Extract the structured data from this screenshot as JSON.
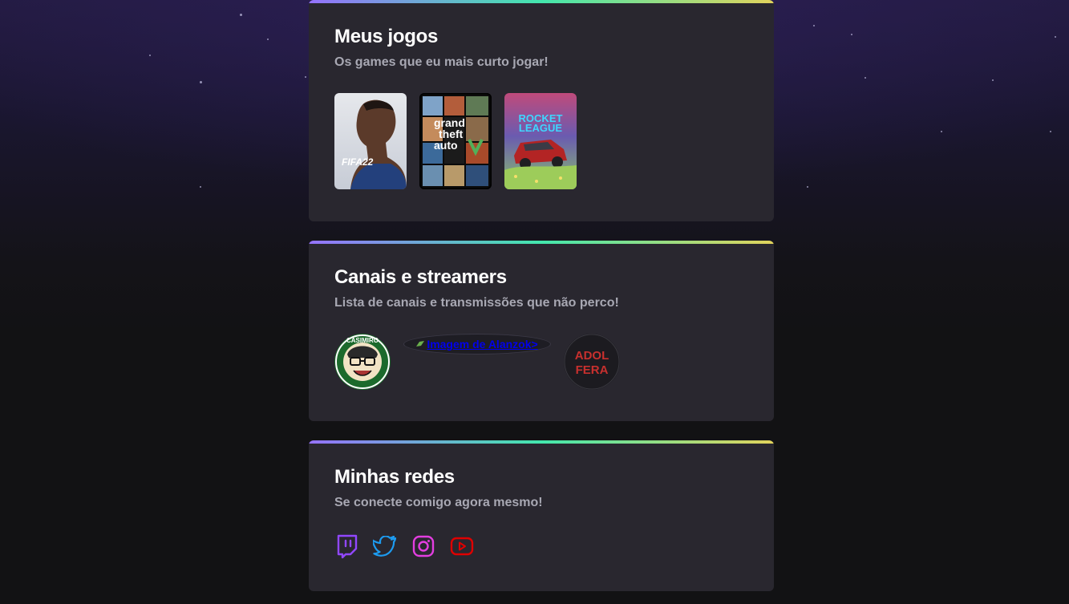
{
  "cards": {
    "games": {
      "title": "Meus jogos",
      "subtitle": "Os games que eu mais curto jogar!",
      "items": [
        {
          "name": "FIFA 22",
          "logo_text": "FIFA22"
        },
        {
          "name": "Grand Theft Auto V",
          "logo_text": [
            "grand",
            "theft",
            "auto"
          ]
        },
        {
          "name": "Rocket League",
          "logo_text": [
            "ROCKET",
            "LEAGUE"
          ]
        }
      ]
    },
    "streamers": {
      "title": "Canais e streamers",
      "subtitle": "Lista de canais e transmissões que não perco!",
      "items": [
        {
          "name": "Casimiro",
          "ring_text": "CASIMIRO"
        },
        {
          "name": "Alanzoka",
          "broken_alt": "Imagem de Alanzok>"
        },
        {
          "name": "Adolfera",
          "logo_text": [
            "ADOL",
            "FERA"
          ]
        }
      ]
    },
    "socials": {
      "title": "Minhas redes",
      "subtitle": "Se conecte comigo agora mesmo!",
      "items": [
        {
          "name": "twitch",
          "icon": "twitch-icon",
          "color": "#9147ff"
        },
        {
          "name": "twitter",
          "icon": "twitter-icon",
          "color": "#1d9bf0"
        },
        {
          "name": "instagram",
          "icon": "instagram-icon",
          "color": "#e33ee0"
        },
        {
          "name": "youtube",
          "icon": "youtube-icon",
          "color": "#df0000"
        }
      ]
    }
  },
  "colors": {
    "card_bg": "#29272f",
    "page_bg": "#121214",
    "title": "#ffffff",
    "subtitle": "#a8a8b3",
    "gradient": [
      "#9572fc",
      "#43e7ad",
      "#e2d45c"
    ]
  }
}
